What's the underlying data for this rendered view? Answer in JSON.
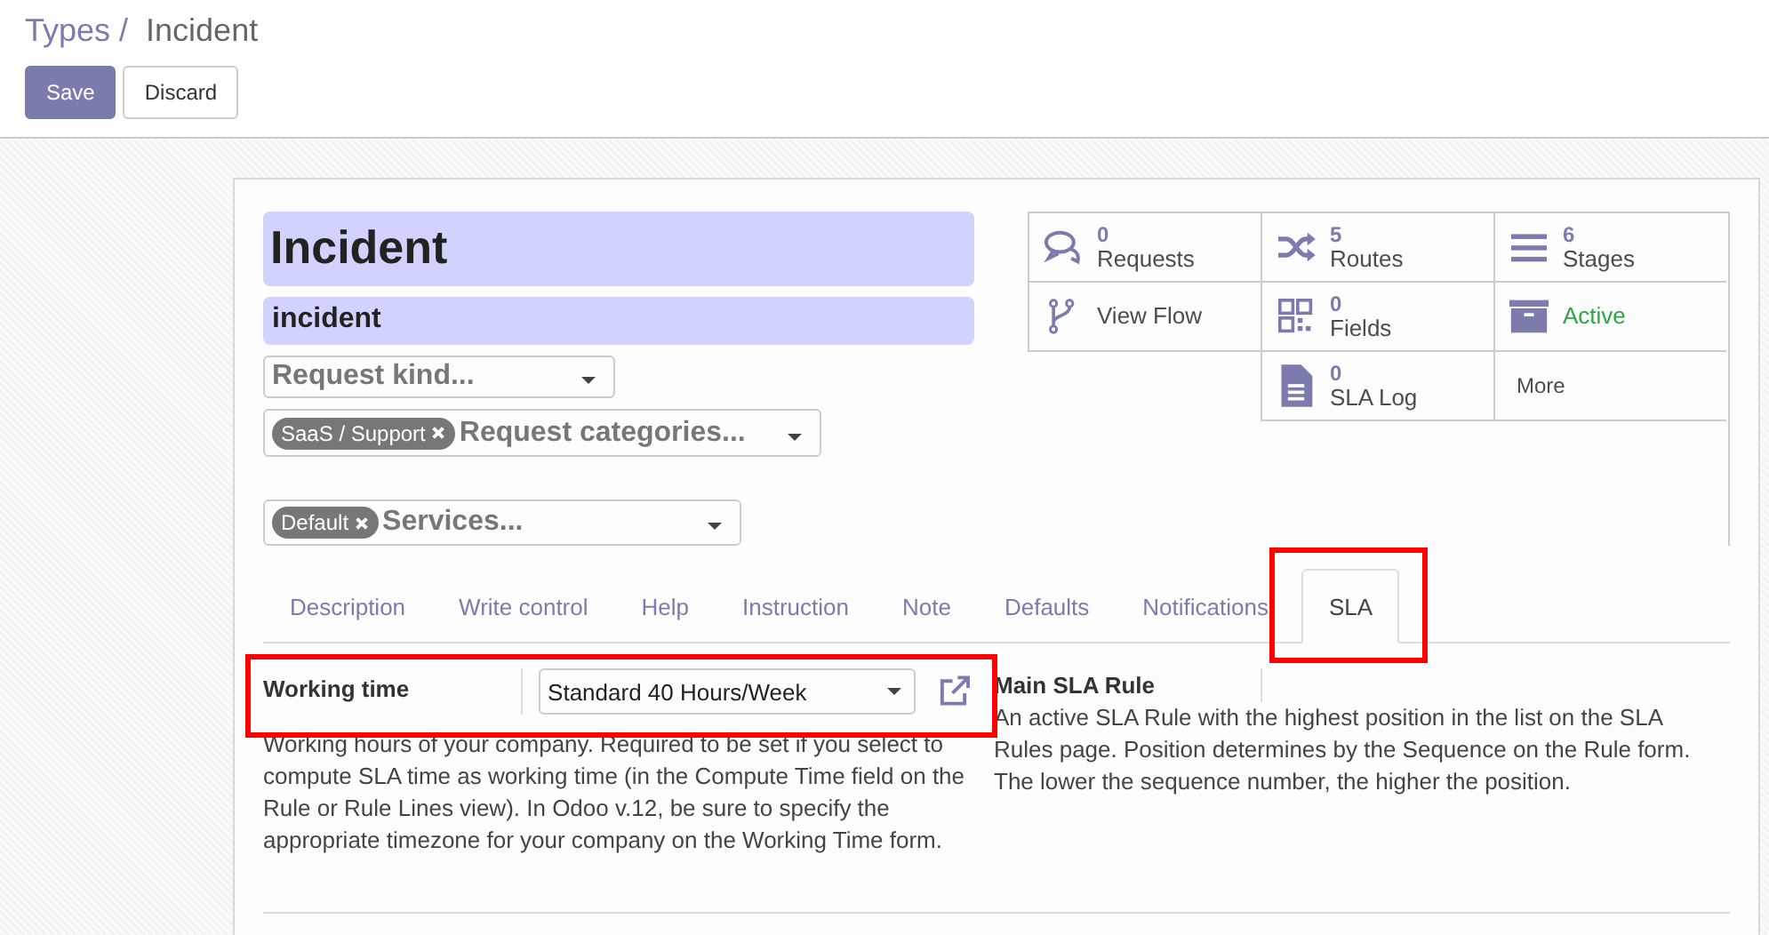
{
  "breadcrumb": {
    "parent": "Types /",
    "current": "Incident"
  },
  "buttons": [
    {
      "label": "Save",
      "primary": true
    },
    {
      "label": "Discard",
      "primary": false
    }
  ],
  "form": {
    "name": "Incident",
    "code": "incident",
    "request_kind": {
      "placeholder": "Request kind..."
    },
    "request_categories": {
      "tags": [
        "SaaS / Support"
      ],
      "placeholder": "Request categories..."
    },
    "services": {
      "tags": [
        "Default"
      ],
      "placeholder": "Services..."
    }
  },
  "button_box": {
    "rows": [
      [
        {
          "kind": "stat",
          "count": "0",
          "label": "Requests"
        },
        {
          "kind": "stat",
          "count": "5",
          "label": "Routes"
        },
        {
          "kind": "stat",
          "count": "6",
          "label": "Stages"
        }
      ],
      [
        {
          "kind": "action",
          "label": "View Flow"
        },
        {
          "kind": "stat",
          "count": "0",
          "label": "Fields"
        },
        {
          "kind": "toggle",
          "label": "Active",
          "active": true
        }
      ],
      [
        "",
        {
          "kind": "stat",
          "count": "0",
          "label": "SLA Log"
        },
        {
          "kind": "more",
          "label": "More"
        }
      ]
    ]
  },
  "tabs": [
    {
      "label": "Description",
      "selected": false,
      "highlighted": false
    },
    {
      "label": "Write control",
      "selected": false,
      "highlighted": false
    },
    {
      "label": "Help",
      "selected": false,
      "highlighted": false
    },
    {
      "label": "Instruction",
      "selected": false,
      "highlighted": false
    },
    {
      "label": "Note",
      "selected": false,
      "highlighted": false
    },
    {
      "label": "Defaults",
      "selected": false,
      "highlighted": false
    },
    {
      "label": "Notifications",
      "selected": false,
      "highlighted": false
    },
    {
      "label": "SLA",
      "selected": true,
      "highlighted": true
    }
  ],
  "sla": {
    "working_time": {
      "label": "Working time",
      "value": "Standard 40 Hours/Week",
      "highlighted": true,
      "help": "Working hours of your company. Required to be set if you select to compute SLA time as working time (in the Compute Time field on the Rule or Rule Lines view). In Odoo v.12, be sure to specify the appropriate timezone for your company on the Working Time form."
    },
    "main_rule": {
      "label": "Main SLA Rule",
      "help": "An active SLA Rule with the highest position in the list on the SLA Rules page. Position determines by the Sequence on the Rule form. The lower the sequence number, the higher the position."
    }
  }
}
